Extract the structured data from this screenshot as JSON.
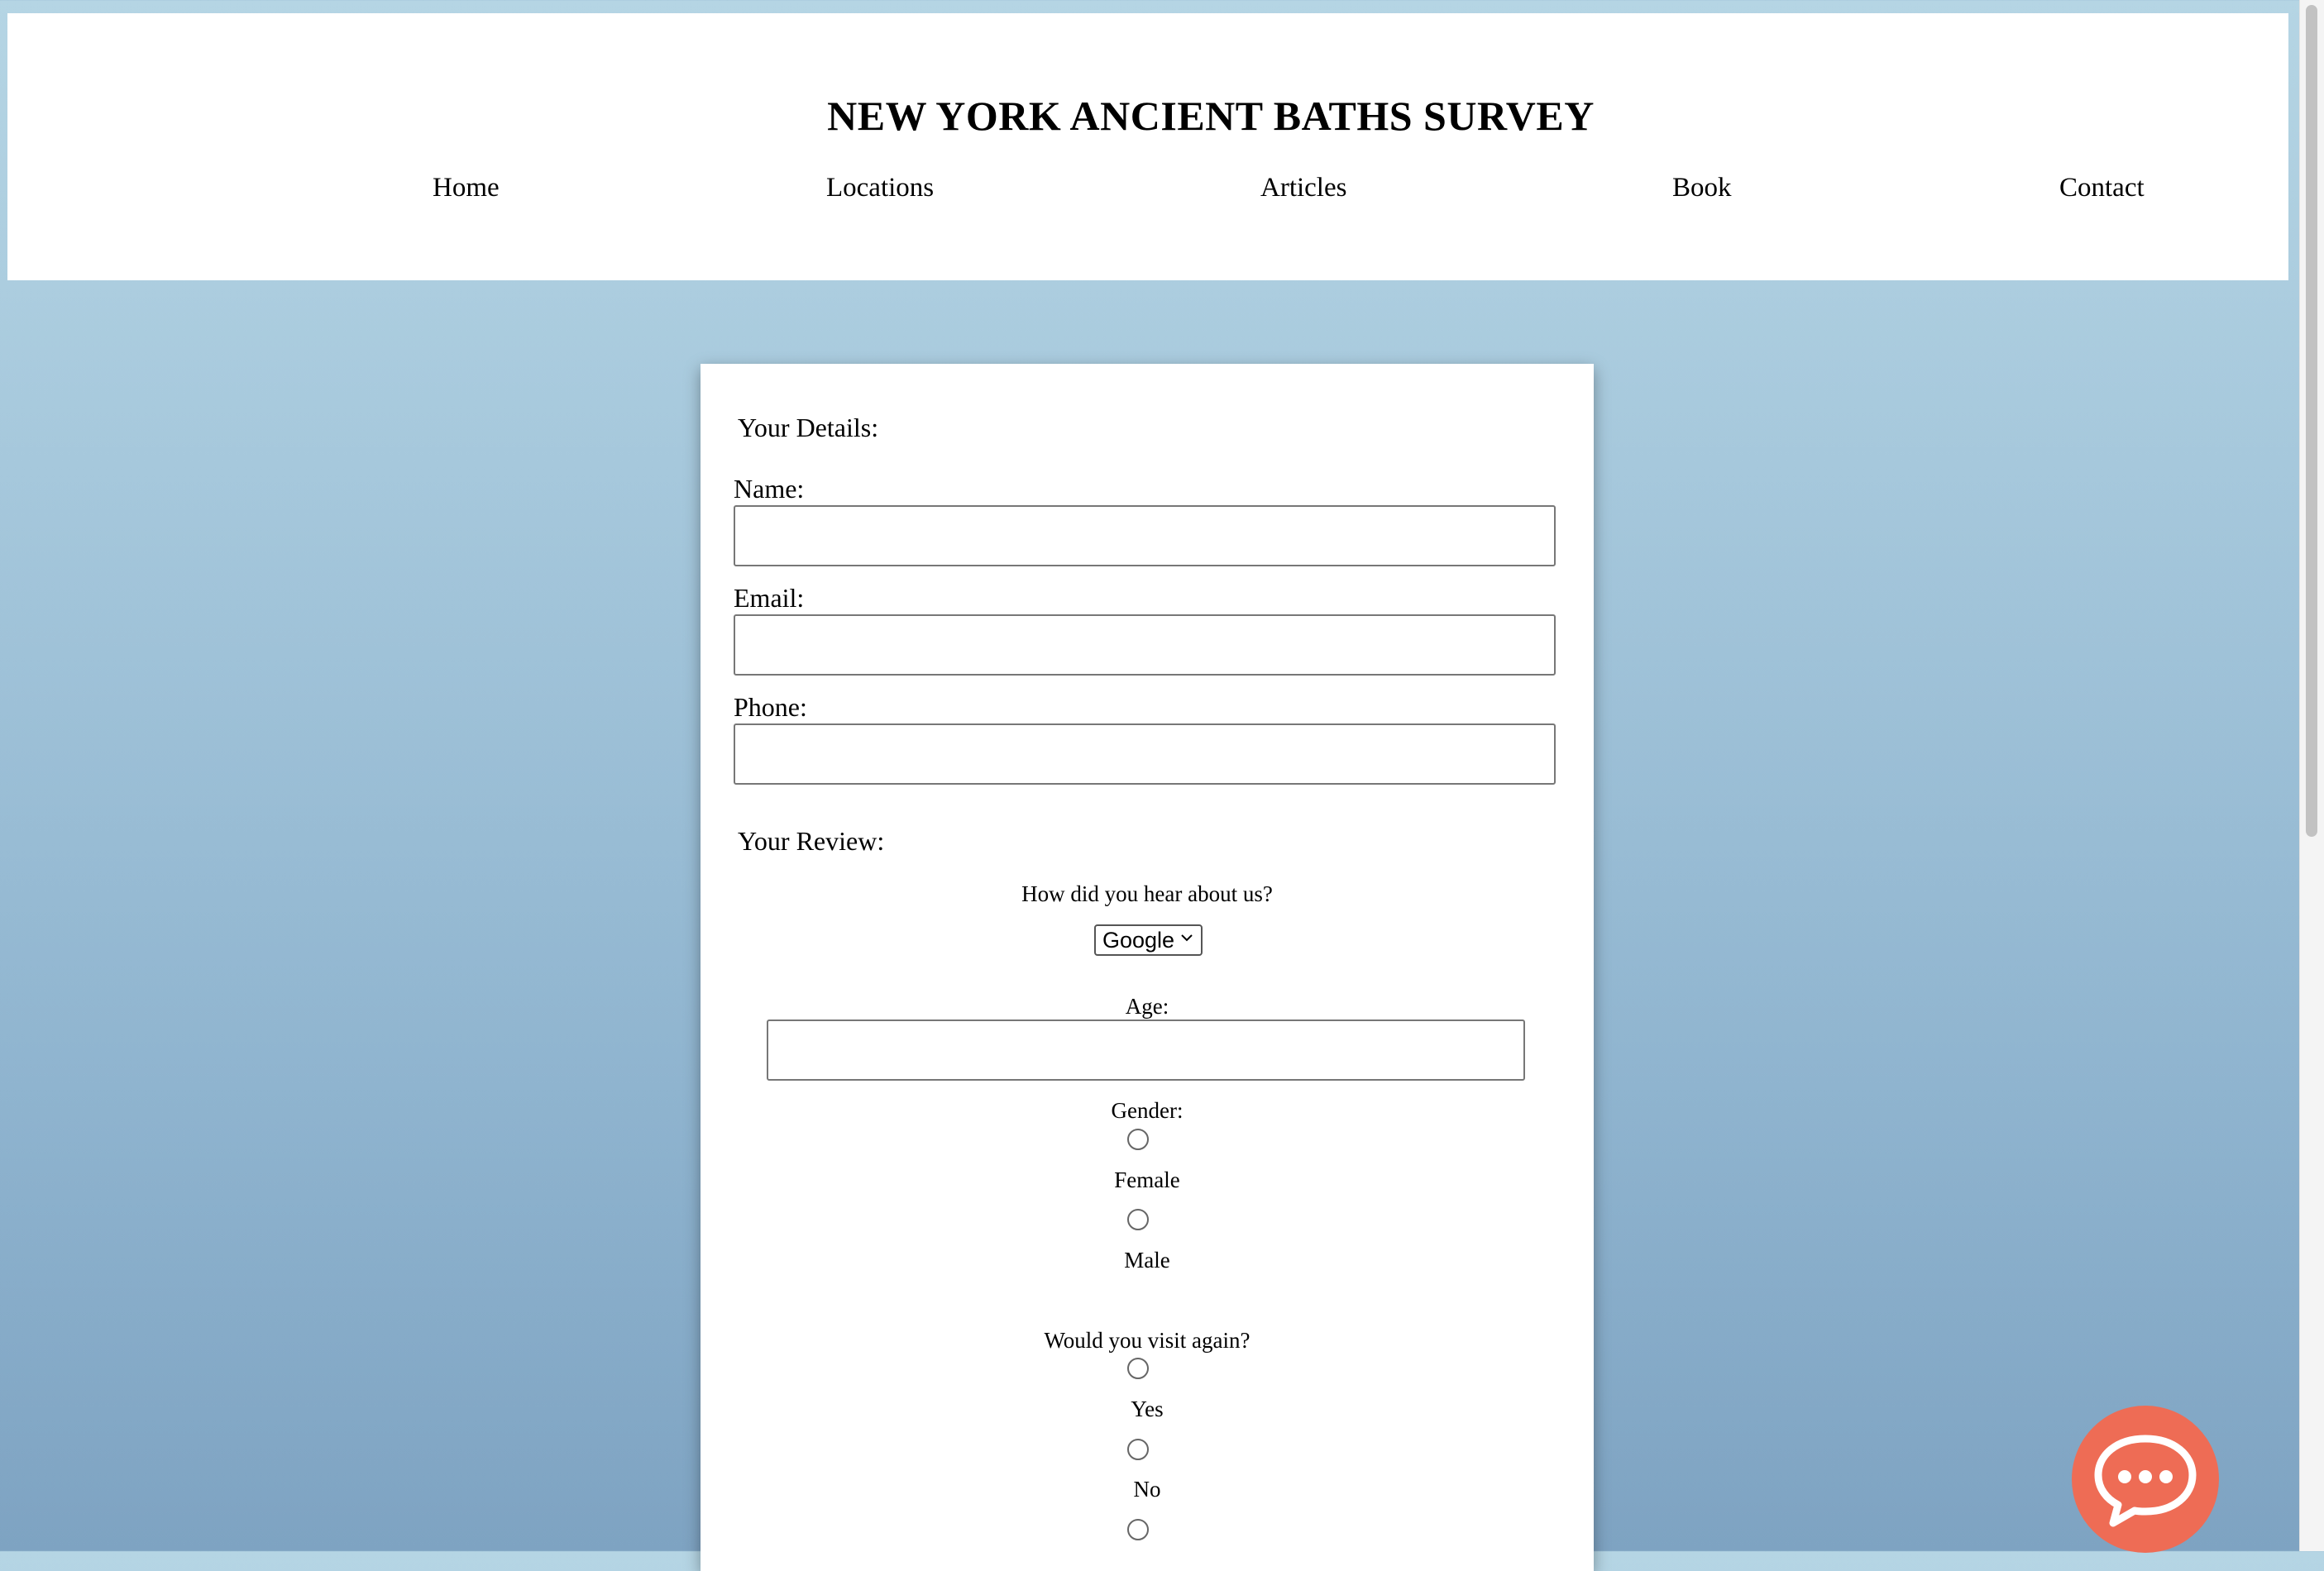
{
  "header": {
    "title": "NEW YORK ANCIENT BATHS SURVEY",
    "nav": [
      "Home",
      "Locations",
      "Articles",
      "Book",
      "Contact"
    ]
  },
  "form": {
    "details_heading": "Your Details:",
    "name_label": "Name:",
    "name_value": "",
    "email_label": "Email:",
    "email_value": "",
    "phone_label": "Phone:",
    "phone_value": "",
    "review_heading": "Your Review:",
    "hear_label": "How did you hear about us?",
    "hear_selected": "Google",
    "age_label": "Age:",
    "age_value": "",
    "gender_label": "Gender:",
    "gender_options": [
      "Female",
      "Male"
    ],
    "visit_label": "Would you visit again?",
    "visit_options": [
      "Yes",
      "No"
    ]
  },
  "colors": {
    "background_top": "#b5d5e4",
    "background_bottom": "#7ea3c2",
    "chat_button": "#ee6c55"
  },
  "icons": {
    "chat": "chat-bubble-icon",
    "dropdown": "chevron-down-icon"
  }
}
